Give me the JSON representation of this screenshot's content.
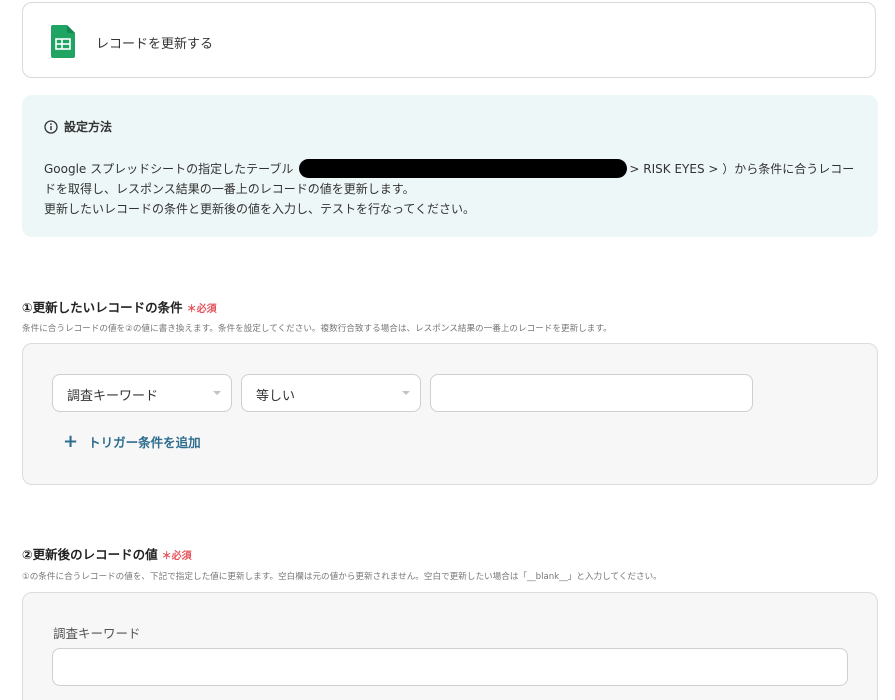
{
  "app": {
    "title": "レコードを更新する",
    "icon": "google-sheets-icon",
    "icon_color": "#1fa463"
  },
  "info": {
    "title": "設定方法",
    "line1_prefix": "Google スプレッドシートの指定したテーブル",
    "line1_suffix": "> RISK EYES > ）から条件に合うレコー",
    "line2": "ドを取得し、レスポンス結果の一番上のレコードの値を更新します。",
    "line3": "更新したいレコードの条件と更新後の値を入力し、テストを行なってください。",
    "background": "#eef7f8"
  },
  "section1": {
    "title": "①更新したいレコードの条件",
    "required": "＊必須",
    "description": "条件に合うレコードの値を②の値に書き換えます。条件を設定してください。複数行合致する場合は、レスポンス結果の一番上のレコードを更新します。",
    "field_select": "調査キーワード",
    "operator_select": "等しい",
    "value_input": "",
    "add_condition": "トリガー条件を追加"
  },
  "section2": {
    "title": "②更新後のレコードの値",
    "required": "＊必須",
    "description": "①の条件に合うレコードの値を、下記で指定した値に更新します。空白欄は元の値から更新されません。空白で更新したい場合は「__blank__」と入力してください。",
    "field_label": "調査キーワード",
    "field_value": ""
  },
  "colors": {
    "accent": "#2f6e8f",
    "required": "#e5545c"
  }
}
